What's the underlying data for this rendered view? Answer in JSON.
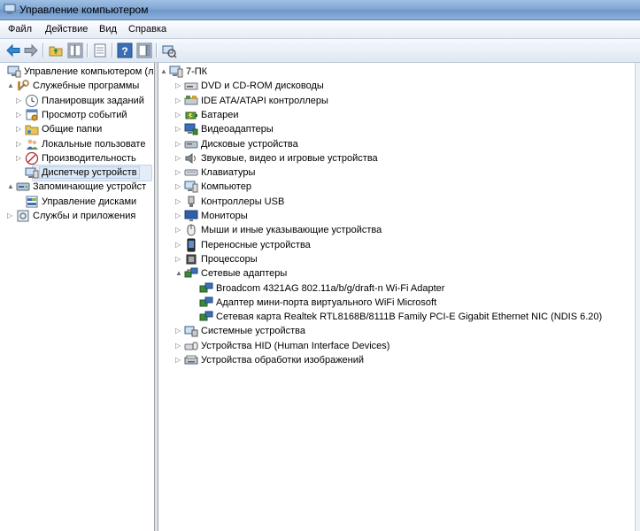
{
  "window": {
    "title": "Управление компьютером"
  },
  "menu": [
    "Файл",
    "Действие",
    "Вид",
    "Справка"
  ],
  "toolbar": {
    "icons": [
      "back-arrow-icon",
      "forward-arrow-icon",
      "up-folder-icon",
      "show-hide-tree-icon",
      "properties-icon",
      "help-icon",
      "action-pane-icon",
      "scan-hardware-icon"
    ]
  },
  "left_tree": [
    {
      "label": "Управление компьютером (л",
      "level": 0,
      "arrow": "",
      "icon": "computer-management-icon"
    },
    {
      "label": "Служебные программы",
      "level": 1,
      "arrow": "▲",
      "icon": "tools-icon"
    },
    {
      "label": "Планировщик заданий",
      "level": 2,
      "arrow": "▷",
      "icon": "clock-icon"
    },
    {
      "label": "Просмотр событий",
      "level": 2,
      "arrow": "▷",
      "icon": "event-viewer-icon"
    },
    {
      "label": "Общие папки",
      "level": 2,
      "arrow": "▷",
      "icon": "shared-folder-icon"
    },
    {
      "label": "Локальные пользовате",
      "level": 2,
      "arrow": "▷",
      "icon": "users-icon"
    },
    {
      "label": "Производительность",
      "level": 2,
      "arrow": "▷",
      "icon": "performance-icon"
    },
    {
      "label": "Диспетчер устройств",
      "level": 2,
      "arrow": "",
      "icon": "device-manager-icon",
      "selected": true
    },
    {
      "label": "Запоминающие устройст",
      "level": 1,
      "arrow": "▲",
      "icon": "storage-icon"
    },
    {
      "label": "Управление дисками",
      "level": 2,
      "arrow": "",
      "icon": "disk-management-icon"
    },
    {
      "label": "Службы и приложения",
      "level": 1,
      "arrow": "▷",
      "icon": "services-icon"
    }
  ],
  "device_tree": [
    {
      "label": "7-ПК",
      "level": 0,
      "arrow": "▲",
      "icon": "computer-root-icon"
    },
    {
      "label": "DVD и CD-ROM дисководы",
      "level": 1,
      "arrow": "▷",
      "icon": "dvd-drive-icon"
    },
    {
      "label": "IDE ATA/ATAPI контроллеры",
      "level": 1,
      "arrow": "▷",
      "icon": "ide-controller-icon"
    },
    {
      "label": "Батареи",
      "level": 1,
      "arrow": "▷",
      "icon": "battery-icon"
    },
    {
      "label": "Видеоадаптеры",
      "level": 1,
      "arrow": "▷",
      "icon": "display-adapter-icon"
    },
    {
      "label": "Дисковые устройства",
      "level": 1,
      "arrow": "▷",
      "icon": "disk-drive-icon"
    },
    {
      "label": "Звуковые, видео и игровые устройства",
      "level": 1,
      "arrow": "▷",
      "icon": "sound-icon"
    },
    {
      "label": "Клавиатуры",
      "level": 1,
      "arrow": "▷",
      "icon": "keyboard-icon"
    },
    {
      "label": "Компьютер",
      "level": 1,
      "arrow": "▷",
      "icon": "computer-icon"
    },
    {
      "label": "Контроллеры USB",
      "level": 1,
      "arrow": "▷",
      "icon": "usb-icon"
    },
    {
      "label": "Мониторы",
      "level": 1,
      "arrow": "▷",
      "icon": "monitor-icon"
    },
    {
      "label": "Мыши и иные указывающие устройства",
      "level": 1,
      "arrow": "▷",
      "icon": "mouse-icon"
    },
    {
      "label": "Переносные устройства",
      "level": 1,
      "arrow": "▷",
      "icon": "portable-device-icon"
    },
    {
      "label": "Процессоры",
      "level": 1,
      "arrow": "▷",
      "icon": "processor-icon"
    },
    {
      "label": "Сетевые адаптеры",
      "level": 1,
      "arrow": "▲",
      "icon": "network-adapter-icon"
    },
    {
      "label": "Broadcom 4321AG 802.11a/b/g/draft-n Wi-Fi Adapter",
      "level": 2,
      "arrow": "",
      "icon": "network-card-icon"
    },
    {
      "label": "Адаптер мини-порта виртуального WiFi Microsoft",
      "level": 2,
      "arrow": "",
      "icon": "network-card-icon"
    },
    {
      "label": "Сетевая карта Realtek RTL8168B/8111B Family PCI-E Gigabit Ethernet NIC (NDIS 6.20)",
      "level": 2,
      "arrow": "",
      "icon": "network-card-icon"
    },
    {
      "label": "Системные устройства",
      "level": 1,
      "arrow": "▷",
      "icon": "system-devices-icon"
    },
    {
      "label": "Устройства HID (Human Interface Devices)",
      "level": 1,
      "arrow": "▷",
      "icon": "hid-icon"
    },
    {
      "label": "Устройства обработки изображений",
      "level": 1,
      "arrow": "▷",
      "icon": "imaging-icon"
    }
  ]
}
